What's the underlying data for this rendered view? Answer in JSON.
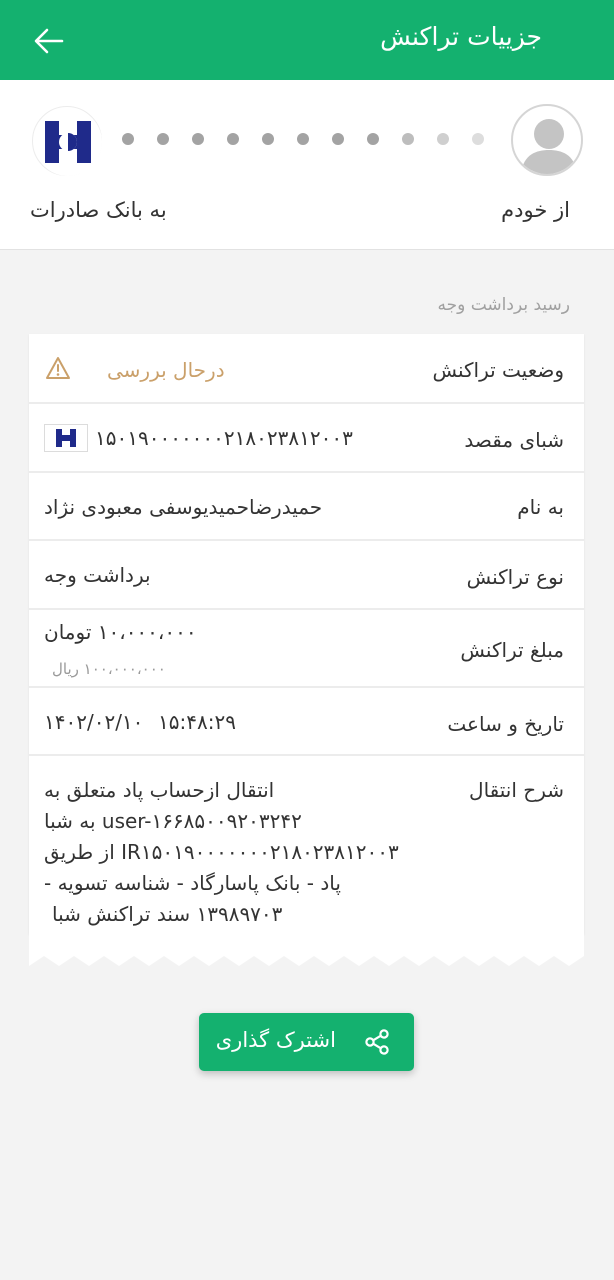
{
  "header": {
    "title": "جزییات تراکنش",
    "back_icon": "arrow-left-icon"
  },
  "transfer": {
    "from_label": "از خودم",
    "to_label": "به بانک صادرات",
    "source_avatar_icon": "user-avatar-icon",
    "bank_logo_icon": "bank-saderat-logo-icon"
  },
  "receipt": {
    "section_title": "رسید برداشت وجه",
    "status": {
      "label": "وضعیت تراکنش",
      "value": "درحال بررسی",
      "icon": "warning-triangle-icon"
    },
    "shaba": {
      "label": "شبای مقصد",
      "value": "۱۵۰۱۹۰۰۰۰۰۰۰۲۱۸۰۲۳۸۱۲۰۰۳"
    },
    "name": {
      "label": "به نام",
      "value": "حمیدرضاحمیدیوسفی معبودی نژاد"
    },
    "type": {
      "label": "نوع تراکنش",
      "value": "برداشت وجه"
    },
    "amount": {
      "label": "مبلغ تراکنش",
      "value": "۱۰،۰۰۰،۰۰۰ تومان",
      "sub_value": "۱۰۰،۰۰۰،۰۰۰ ریال"
    },
    "datetime": {
      "label": "تاریخ و ساعت",
      "date": "۱۴۰۲/۰۲/۱۰",
      "time": "۱۵:۴۸:۲۹"
    },
    "description": {
      "label": "شرح انتقال",
      "lines": [
        "انتقال ازحساب پاد متعلق به",
        "user-۱۶۶۸۵۰۰۹۲۰۳۲۴۲ به شبا",
        "IR۱۵۰۱۹۰۰۰۰۰۰۰۲۱۸۰۲۳۸۱۲۰۰۳ از طریق",
        "پاد - بانک پاسارگاد - شناسه تسویه -",
        "۱۳۹۸۹۷۰۳ سند تراکنش شبا"
      ]
    }
  },
  "actions": {
    "share_label": "اشترک گذاری",
    "share_icon": "share-icon"
  },
  "colors": {
    "primary": "#14b16f",
    "pending": "#caa06a",
    "bank_blue": "#1f2a8a"
  }
}
